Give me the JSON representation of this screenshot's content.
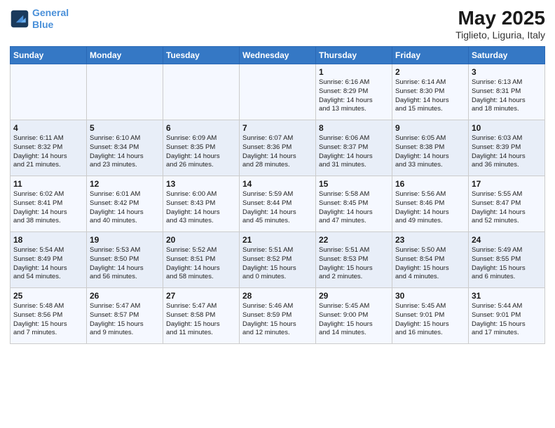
{
  "logo": {
    "line1": "General",
    "line2": "Blue"
  },
  "title": "May 2025",
  "subtitle": "Tiglieto, Liguria, Italy",
  "days_of_week": [
    "Sunday",
    "Monday",
    "Tuesday",
    "Wednesday",
    "Thursday",
    "Friday",
    "Saturday"
  ],
  "weeks": [
    [
      {
        "num": "",
        "info": ""
      },
      {
        "num": "",
        "info": ""
      },
      {
        "num": "",
        "info": ""
      },
      {
        "num": "",
        "info": ""
      },
      {
        "num": "1",
        "info": "Sunrise: 6:16 AM\nSunset: 8:29 PM\nDaylight: 14 hours\nand 13 minutes."
      },
      {
        "num": "2",
        "info": "Sunrise: 6:14 AM\nSunset: 8:30 PM\nDaylight: 14 hours\nand 15 minutes."
      },
      {
        "num": "3",
        "info": "Sunrise: 6:13 AM\nSunset: 8:31 PM\nDaylight: 14 hours\nand 18 minutes."
      }
    ],
    [
      {
        "num": "4",
        "info": "Sunrise: 6:11 AM\nSunset: 8:32 PM\nDaylight: 14 hours\nand 21 minutes."
      },
      {
        "num": "5",
        "info": "Sunrise: 6:10 AM\nSunset: 8:34 PM\nDaylight: 14 hours\nand 23 minutes."
      },
      {
        "num": "6",
        "info": "Sunrise: 6:09 AM\nSunset: 8:35 PM\nDaylight: 14 hours\nand 26 minutes."
      },
      {
        "num": "7",
        "info": "Sunrise: 6:07 AM\nSunset: 8:36 PM\nDaylight: 14 hours\nand 28 minutes."
      },
      {
        "num": "8",
        "info": "Sunrise: 6:06 AM\nSunset: 8:37 PM\nDaylight: 14 hours\nand 31 minutes."
      },
      {
        "num": "9",
        "info": "Sunrise: 6:05 AM\nSunset: 8:38 PM\nDaylight: 14 hours\nand 33 minutes."
      },
      {
        "num": "10",
        "info": "Sunrise: 6:03 AM\nSunset: 8:39 PM\nDaylight: 14 hours\nand 36 minutes."
      }
    ],
    [
      {
        "num": "11",
        "info": "Sunrise: 6:02 AM\nSunset: 8:41 PM\nDaylight: 14 hours\nand 38 minutes."
      },
      {
        "num": "12",
        "info": "Sunrise: 6:01 AM\nSunset: 8:42 PM\nDaylight: 14 hours\nand 40 minutes."
      },
      {
        "num": "13",
        "info": "Sunrise: 6:00 AM\nSunset: 8:43 PM\nDaylight: 14 hours\nand 43 minutes."
      },
      {
        "num": "14",
        "info": "Sunrise: 5:59 AM\nSunset: 8:44 PM\nDaylight: 14 hours\nand 45 minutes."
      },
      {
        "num": "15",
        "info": "Sunrise: 5:58 AM\nSunset: 8:45 PM\nDaylight: 14 hours\nand 47 minutes."
      },
      {
        "num": "16",
        "info": "Sunrise: 5:56 AM\nSunset: 8:46 PM\nDaylight: 14 hours\nand 49 minutes."
      },
      {
        "num": "17",
        "info": "Sunrise: 5:55 AM\nSunset: 8:47 PM\nDaylight: 14 hours\nand 52 minutes."
      }
    ],
    [
      {
        "num": "18",
        "info": "Sunrise: 5:54 AM\nSunset: 8:49 PM\nDaylight: 14 hours\nand 54 minutes."
      },
      {
        "num": "19",
        "info": "Sunrise: 5:53 AM\nSunset: 8:50 PM\nDaylight: 14 hours\nand 56 minutes."
      },
      {
        "num": "20",
        "info": "Sunrise: 5:52 AM\nSunset: 8:51 PM\nDaylight: 14 hours\nand 58 minutes."
      },
      {
        "num": "21",
        "info": "Sunrise: 5:51 AM\nSunset: 8:52 PM\nDaylight: 15 hours\nand 0 minutes."
      },
      {
        "num": "22",
        "info": "Sunrise: 5:51 AM\nSunset: 8:53 PM\nDaylight: 15 hours\nand 2 minutes."
      },
      {
        "num": "23",
        "info": "Sunrise: 5:50 AM\nSunset: 8:54 PM\nDaylight: 15 hours\nand 4 minutes."
      },
      {
        "num": "24",
        "info": "Sunrise: 5:49 AM\nSunset: 8:55 PM\nDaylight: 15 hours\nand 6 minutes."
      }
    ],
    [
      {
        "num": "25",
        "info": "Sunrise: 5:48 AM\nSunset: 8:56 PM\nDaylight: 15 hours\nand 7 minutes."
      },
      {
        "num": "26",
        "info": "Sunrise: 5:47 AM\nSunset: 8:57 PM\nDaylight: 15 hours\nand 9 minutes."
      },
      {
        "num": "27",
        "info": "Sunrise: 5:47 AM\nSunset: 8:58 PM\nDaylight: 15 hours\nand 11 minutes."
      },
      {
        "num": "28",
        "info": "Sunrise: 5:46 AM\nSunset: 8:59 PM\nDaylight: 15 hours\nand 12 minutes."
      },
      {
        "num": "29",
        "info": "Sunrise: 5:45 AM\nSunset: 9:00 PM\nDaylight: 15 hours\nand 14 minutes."
      },
      {
        "num": "30",
        "info": "Sunrise: 5:45 AM\nSunset: 9:01 PM\nDaylight: 15 hours\nand 16 minutes."
      },
      {
        "num": "31",
        "info": "Sunrise: 5:44 AM\nSunset: 9:01 PM\nDaylight: 15 hours\nand 17 minutes."
      }
    ]
  ]
}
